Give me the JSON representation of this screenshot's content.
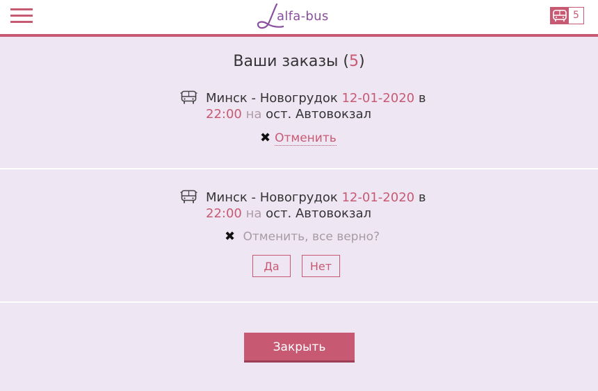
{
  "header": {
    "logo_text": "alfa-bus",
    "cart_count": "5"
  },
  "title": {
    "text": "Ваши заказы (",
    "count": "5",
    "close_paren": ")"
  },
  "orders": [
    {
      "route": "Минск - Новогрудок",
      "date": "12-01-2020",
      "in_word": "в",
      "time": "22:00",
      "on_word": "на",
      "stop": "ост. Автовокзал",
      "cancel_label": "Отменить"
    },
    {
      "route": "Минск - Новогрудок",
      "date": "12-01-2020",
      "in_word": "в",
      "time": "22:00",
      "on_word": "на",
      "stop": "ост. Автовокзал",
      "confirm_text": "Отменить, все верно?",
      "yes_label": "Да",
      "no_label": "Нет"
    }
  ],
  "close_button": "Закрыть",
  "icons": {
    "menu": "hamburger-icon",
    "bus": "bus-icon",
    "cancel": "x-icon"
  },
  "colors": {
    "accent": "#c75a72",
    "background": "#efe6f4",
    "logo": "#8a4f9e"
  }
}
